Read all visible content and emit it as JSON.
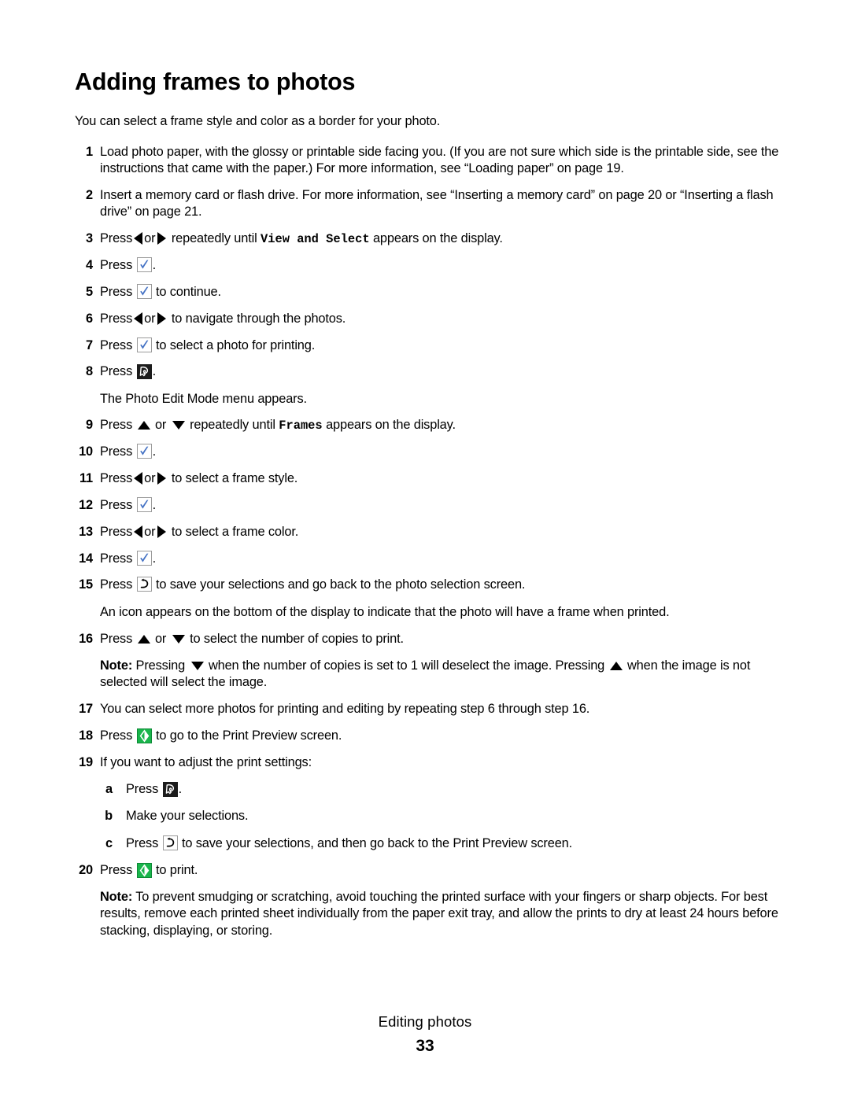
{
  "document": {
    "title": "Adding frames to photos",
    "intro": "You can select a frame style and color as a border for your photo."
  },
  "steps": [
    {
      "num": "1",
      "text": "Load photo paper, with the glossy or printable side facing you. (If you are not sure which side is the printable side, see the instructions that came with the paper.) For more information, see “Loading paper” on page 19."
    },
    {
      "num": "2",
      "text": "Insert a memory card or flash drive. For more information, see “Inserting a memory card” on page 20 or “Inserting a flash drive” on page 21."
    },
    {
      "num": "3",
      "pre": "Press",
      "mid": "or",
      "post": "repeatedly until",
      "mono": "View and Select",
      "tail": "appears on the display."
    },
    {
      "num": "4",
      "pre": "Press",
      "tail": "."
    },
    {
      "num": "5",
      "pre": "Press",
      "tail": "to continue."
    },
    {
      "num": "6",
      "pre": "Press",
      "mid": "or",
      "tail": "to navigate through the photos."
    },
    {
      "num": "7",
      "pre": "Press",
      "tail": "to select a photo for printing."
    },
    {
      "num": "8",
      "pre": "Press",
      "tail": ".",
      "sub": "The Photo Edit Mode menu appears."
    },
    {
      "num": "9",
      "pre": "Press",
      "mid": "or",
      "post": "repeatedly until",
      "mono": "Frames",
      "tail": "appears on the display."
    },
    {
      "num": "10",
      "pre": "Press",
      "tail": "."
    },
    {
      "num": "11",
      "pre": "Press",
      "mid": "or",
      "tail": "to select a frame style."
    },
    {
      "num": "12",
      "pre": "Press",
      "tail": "."
    },
    {
      "num": "13",
      "pre": "Press",
      "mid": "or",
      "tail": "to select a frame color."
    },
    {
      "num": "14",
      "pre": "Press",
      "tail": "."
    },
    {
      "num": "15",
      "pre": "Press",
      "tail": "to save your selections and go back to the photo selection screen.",
      "sub": "An icon appears on the bottom of the display to indicate that the photo will have a frame when printed."
    },
    {
      "num": "16",
      "pre": "Press",
      "mid": "or",
      "tail": "to select the number of copies to print.",
      "note_label": "Note:",
      "note_a": "Pressing",
      "note_b": "when the number of copies is set to 1 will deselect the image. Pressing",
      "note_c": "when the image is not selected will select the image."
    },
    {
      "num": "17",
      "text": "You can select more photos for printing and editing by repeating step 6 through step 16."
    },
    {
      "num": "18",
      "pre": "Press",
      "tail": "to go to the Print Preview screen."
    },
    {
      "num": "19",
      "text": "If you want to adjust the print settings:",
      "substeps": [
        {
          "num": "a",
          "pre": "Press",
          "tail": "."
        },
        {
          "num": "b",
          "text": "Make your selections."
        },
        {
          "num": "c",
          "pre": "Press",
          "tail": "to save your selections, and then go back to the Print Preview screen."
        }
      ]
    },
    {
      "num": "20",
      "pre": "Press",
      "tail": "to print.",
      "note_label": "Note:",
      "note_text": "To prevent smudging or scratching, avoid touching the printed surface with your fingers or sharp objects. For best results, remove each printed sheet individually from the paper exit tray, and allow the prints to dry at least 24 hours before stacking, displaying, or storing."
    }
  ],
  "footer": {
    "section": "Editing photos",
    "page_number": "33"
  },
  "colors": {
    "check_blue": "#4472c4",
    "start_green": "#19b54b",
    "menu_dark": "#1c1c1c",
    "button_border": "#9a9a9a",
    "text": "#000000"
  },
  "icons": {
    "check": "check-button-icon",
    "left": "left-arrow-icon",
    "right": "right-arrow-icon",
    "up": "up-arrow-icon",
    "down": "down-arrow-icon",
    "back": "back-button-icon",
    "menu": "menu-button-icon",
    "start": "start-button-icon"
  }
}
